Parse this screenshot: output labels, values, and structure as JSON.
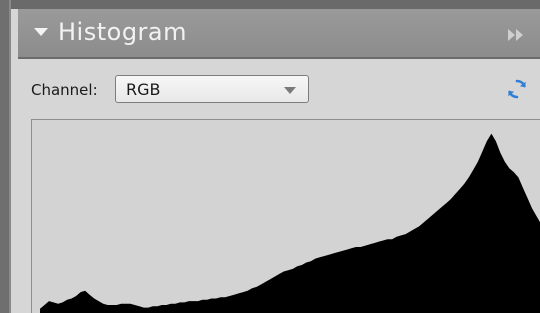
{
  "panel": {
    "title": "Histogram",
    "collapse_icon": "triangle-down-icon",
    "menu_icon": "double-chevron-right-icon"
  },
  "controls": {
    "channel_label": "Channel:",
    "channel_value": "RGB",
    "channel_dropdown_icon": "triangle-down-icon",
    "refresh_icon": "refresh-icon",
    "refresh_color": "#2f7fd6"
  },
  "histogram": {
    "fill_color": "#000000",
    "background_color": "#d3d3d3",
    "values": [
      4,
      7,
      10,
      9,
      8,
      9,
      11,
      12,
      14,
      17,
      18,
      15,
      12,
      10,
      8,
      7,
      7,
      7,
      8,
      8,
      8,
      7,
      6,
      5,
      5,
      6,
      6,
      7,
      7,
      8,
      8,
      9,
      9,
      10,
      10,
      10,
      11,
      11,
      12,
      12,
      13,
      13,
      14,
      15,
      16,
      17,
      18,
      20,
      21,
      23,
      25,
      27,
      29,
      31,
      33,
      34,
      35,
      37,
      38,
      40,
      41,
      43,
      44,
      45,
      46,
      47,
      48,
      49,
      50,
      51,
      52,
      52,
      53,
      54,
      55,
      56,
      57,
      58,
      58,
      60,
      61,
      62,
      64,
      66,
      68,
      71,
      74,
      77,
      80,
      83,
      86,
      89,
      93,
      97,
      101,
      106,
      112,
      118,
      126,
      134,
      140,
      134,
      125,
      118,
      113,
      110,
      106,
      98,
      90,
      82,
      76,
      70
    ]
  }
}
